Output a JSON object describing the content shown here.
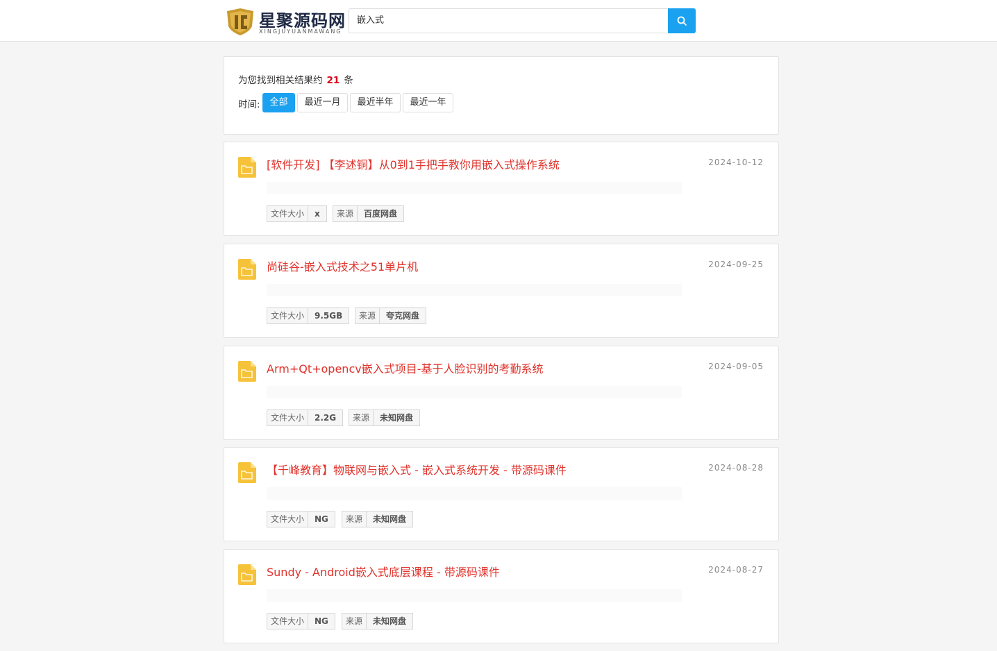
{
  "header": {
    "logo_name": "星聚源码网",
    "logo_pinyin": "XINGJUYUANMAWANG",
    "search_value": "嵌入式"
  },
  "summary": {
    "prefix": "为您找到相关结果约",
    "count": "21",
    "suffix": "条",
    "time_label": "时间:",
    "filters": [
      "全部",
      "最近一月",
      "最近半年",
      "最近一年"
    ],
    "active_filter": "全部"
  },
  "results": [
    {
      "title": "[软件开发] 【李述铜】从0到1手把手教你用嵌入式操作系统",
      "date": "2024-10-12",
      "size_label": "文件大小",
      "size": "x",
      "source_label": "来源",
      "source": "百度网盘"
    },
    {
      "title": "尚硅谷-嵌入式技术之51单片机",
      "date": "2024-09-25",
      "size_label": "文件大小",
      "size": "9.5GB",
      "source_label": "来源",
      "source": "夸克网盘"
    },
    {
      "title": "Arm+Qt+opencv嵌入式项目-基于人脸识别的考勤系统",
      "date": "2024-09-05",
      "size_label": "文件大小",
      "size": "2.2G",
      "source_label": "来源",
      "source": "未知网盘"
    },
    {
      "title": "【千峰教育】物联网与嵌入式 - 嵌入式系统开发 - 带源码课件",
      "date": "2024-08-28",
      "size_label": "文件大小",
      "size": "NG",
      "source_label": "来源",
      "source": "未知网盘"
    },
    {
      "title": "Sundy - Android嵌入式底层课程 - 带源码课件",
      "date": "2024-08-27",
      "size_label": "文件大小",
      "size": "NG",
      "source_label": "来源",
      "source": "未知网盘"
    }
  ],
  "colors": {
    "accent": "#1aa1f0",
    "title_red": "#e0322b",
    "count_red": "#d9001b",
    "folder_yellow": "#f6c23a"
  },
  "icons": [
    "logo-shield-icon",
    "search-icon",
    "folder-file-icon"
  ]
}
